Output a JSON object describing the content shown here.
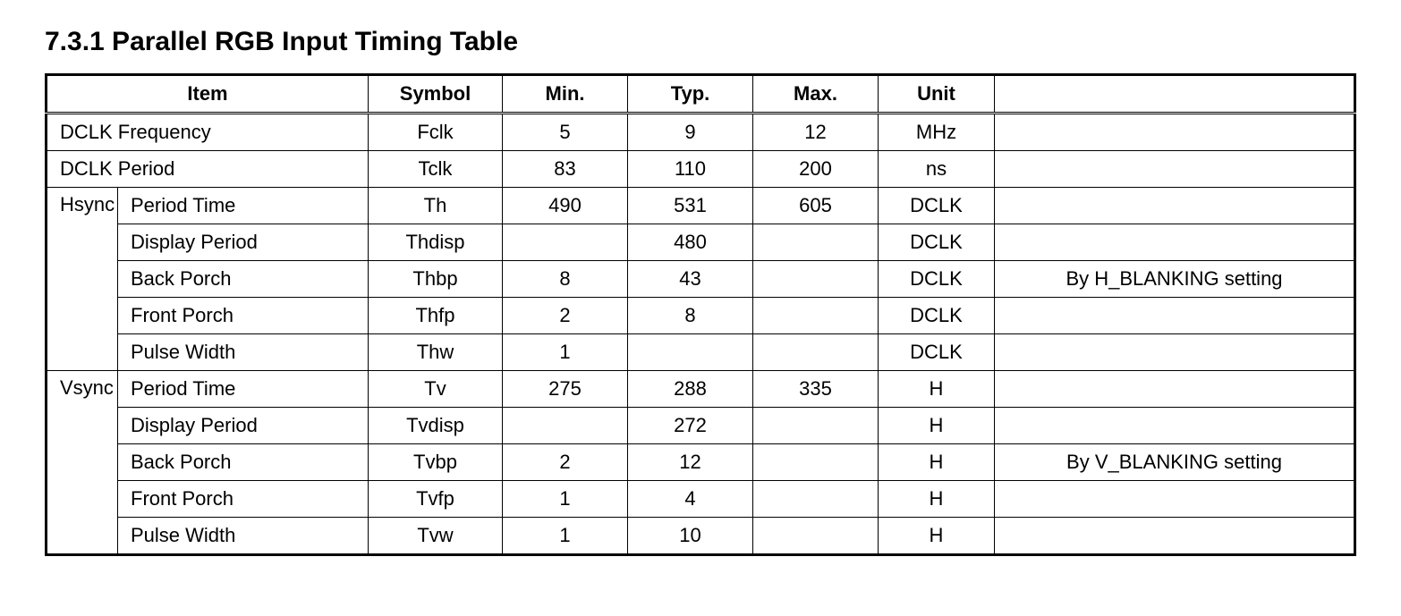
{
  "title": "7.3.1 Parallel RGB Input Timing Table",
  "headers": {
    "item": "Item",
    "symbol": "Symbol",
    "min": "Min.",
    "typ": "Typ.",
    "max": "Max.",
    "unit": "Unit",
    "note": ""
  },
  "rows": [
    {
      "group": "",
      "item": "DCLK Frequency",
      "symbol": "Fclk",
      "min": "5",
      "typ": "9",
      "max": "12",
      "unit": "MHz",
      "note": "",
      "span_item": true
    },
    {
      "group": "",
      "item": "DCLK Period",
      "symbol": "Tclk",
      "min": "83",
      "typ": "110",
      "max": "200",
      "unit": "ns",
      "note": "",
      "span_item": true
    },
    {
      "group": "Hsync",
      "item": "Period Time",
      "symbol": "Th",
      "min": "490",
      "typ": "531",
      "max": "605",
      "unit": "DCLK",
      "note": "",
      "group_start": 5
    },
    {
      "group": "",
      "item": "Display Period",
      "symbol": "Thdisp",
      "min": "",
      "typ": "480",
      "max": "",
      "unit": "DCLK",
      "note": ""
    },
    {
      "group": "",
      "item": "Back Porch",
      "symbol": "Thbp",
      "min": "8",
      "typ": "43",
      "max": "",
      "unit": "DCLK",
      "note": "By H_BLANKING setting"
    },
    {
      "group": "",
      "item": "Front Porch",
      "symbol": "Thfp",
      "min": "2",
      "typ": "8",
      "max": "",
      "unit": "DCLK",
      "note": ""
    },
    {
      "group": "",
      "item": "Pulse Width",
      "symbol": "Thw",
      "min": "1",
      "typ": "",
      "max": "",
      "unit": "DCLK",
      "note": ""
    },
    {
      "group": "Vsync",
      "item": "Period Time",
      "symbol": "Tv",
      "min": "275",
      "typ": "288",
      "max": "335",
      "unit": "H",
      "note": "",
      "group_start": 5
    },
    {
      "group": "",
      "item": "Display Period",
      "symbol": "Tvdisp",
      "min": "",
      "typ": "272",
      "max": "",
      "unit": "H",
      "note": ""
    },
    {
      "group": "",
      "item": "Back Porch",
      "symbol": "Tvbp",
      "min": "2",
      "typ": "12",
      "max": "",
      "unit": "H",
      "note": "By V_BLANKING setting"
    },
    {
      "group": "",
      "item": "Front Porch",
      "symbol": "Tvfp",
      "min": "1",
      "typ": "4",
      "max": "",
      "unit": "H",
      "note": ""
    },
    {
      "group": "",
      "item": "Pulse Width",
      "symbol": "Tvw",
      "min": "1",
      "typ": "10",
      "max": "",
      "unit": "H",
      "note": ""
    }
  ]
}
